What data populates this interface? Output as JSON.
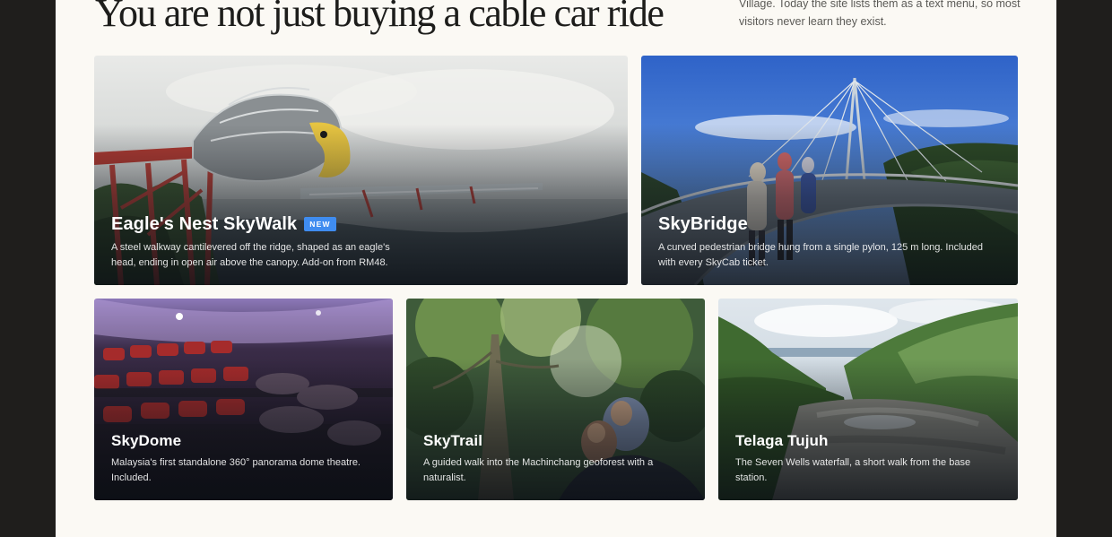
{
  "section": {
    "headline": "You are not just buying a cable car ride",
    "intro": "Village. Today the site lists them as a text menu, so most visitors never learn they exist."
  },
  "cards": [
    {
      "title": "Eagle's Nest SkyWalk",
      "badge": "NEW",
      "description": "A steel walkway cantilevered off the ridge, shaped as an eagle's head, ending in open air above the canopy. Add-on from RM48."
    },
    {
      "title": "SkyBridge",
      "description": "A curved pedestrian bridge hung from a single pylon, 125 m long. Included with every SkyCab ticket."
    },
    {
      "title": "SkyDome",
      "description": "Malaysia's first standalone 360° panorama dome theatre. Included."
    },
    {
      "title": "SkyTrail",
      "description": "A guided walk into the Machinchang geoforest with a naturalist."
    },
    {
      "title": "Telaga Tujuh",
      "description": "The Seven Wells waterfall, a short walk from the base station."
    }
  ],
  "colors": {
    "page_bg": "#fbf9f4",
    "frame_bg": "#1f1e1c",
    "badge": "#3f8cf0",
    "headline": "#1d1d1b"
  }
}
